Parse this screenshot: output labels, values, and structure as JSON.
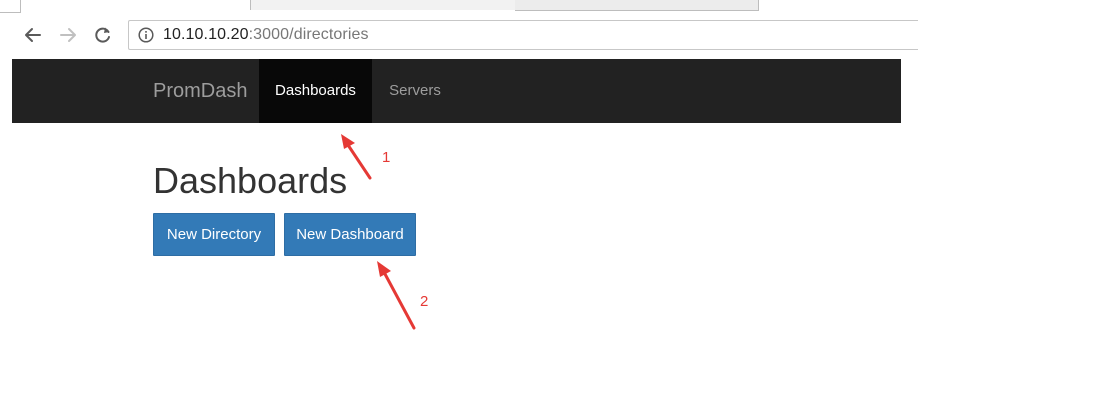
{
  "browser": {
    "url_host": "10.10.10.20",
    "url_rest": ":3000/directories"
  },
  "navbar": {
    "brand": "PromDash",
    "items": [
      {
        "label": "Dashboards",
        "active": true
      },
      {
        "label": "Servers",
        "active": false
      }
    ]
  },
  "main": {
    "title": "Dashboards",
    "buttons": {
      "new_directory": "New Directory",
      "new_dashboard": "New Dashboard"
    }
  },
  "annotations": {
    "marker_1": "1",
    "marker_2": "2",
    "color": "#e53935"
  },
  "colors": {
    "navbar_bg": "#222222",
    "navbar_active_bg": "#080808",
    "primary_button": "#337ab7"
  }
}
